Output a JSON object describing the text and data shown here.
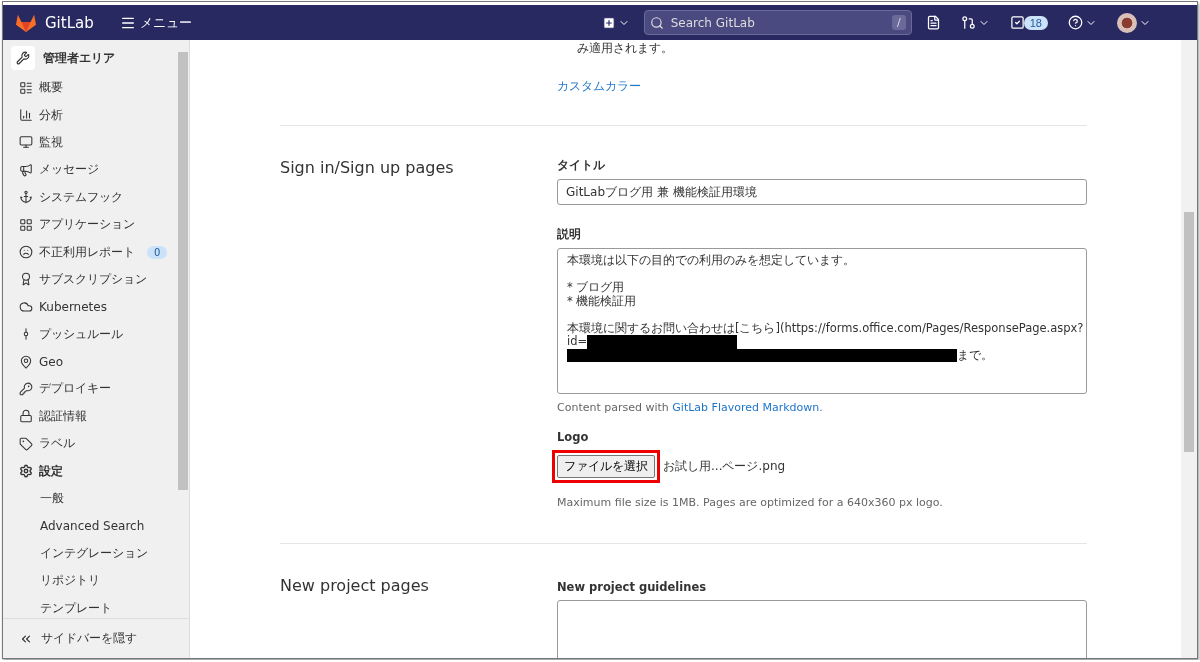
{
  "header": {
    "brand": "GitLab",
    "menu": "メニュー",
    "search": {
      "placeholder": "Search GitLab"
    },
    "search_key": "/",
    "todo_count": "18"
  },
  "sidebar": {
    "title": "管理者エリア",
    "items": [
      {
        "label": "概要",
        "selected": false
      },
      {
        "label": "分析",
        "selected": false
      },
      {
        "label": "監視",
        "selected": false
      },
      {
        "label": "メッセージ",
        "selected": false
      },
      {
        "label": "システムフック",
        "selected": false
      },
      {
        "label": "アプリケーション",
        "selected": false
      },
      {
        "label": "不正利用レポート",
        "selected": false,
        "badge": "0"
      },
      {
        "label": "サブスクリプション",
        "selected": false
      },
      {
        "label": "Kubernetes",
        "selected": false
      },
      {
        "label": "プッシュルール",
        "selected": false
      },
      {
        "label": "Geo",
        "selected": false
      },
      {
        "label": "デプロイキー",
        "selected": false
      },
      {
        "label": "認証情報",
        "selected": false
      },
      {
        "label": "ラベル",
        "selected": false
      },
      {
        "label": "設定",
        "selected": true,
        "children": [
          {
            "label": "一般",
            "selected": false
          },
          {
            "label": "Advanced Search",
            "selected": false
          },
          {
            "label": "インテグレーション",
            "selected": false
          },
          {
            "label": "リポジトリ",
            "selected": false
          },
          {
            "label": "テンプレート",
            "selected": false
          }
        ]
      }
    ],
    "collapse": "サイドバーを隠す"
  },
  "main": {
    "top_note": "み適用されます。",
    "custom_color_link": "カスタムカラー",
    "sign_in": {
      "heading": "Sign in/Sign up pages",
      "title_label": "タイトル",
      "title_value": "GitLabブログ用 兼 機能検証用環境",
      "description_label": "説明",
      "description_paragraphs": [
        {
          "lines": [
            {
              "parts": [
                {
                  "kind": "text",
                  "text": "本環境は以下の目的での利用のみを想定しています。"
                }
              ]
            }
          ]
        },
        {
          "lines": [
            {
              "parts": [
                {
                  "kind": "text",
                  "text": "* ブログ用"
                }
              ]
            },
            {
              "parts": [
                {
                  "kind": "text",
                  "text": "* 機能検証用"
                }
              ]
            }
          ]
        },
        {
          "lines": [
            {
              "parts": [
                {
                  "kind": "text",
                  "text": "本環境に関するお問い合わせは[こちら](https://forms.office.com/Pages/ResponsePage.aspx?"
                }
              ]
            },
            {
              "parts": [
                {
                  "kind": "text",
                  "text": "id="
                },
                {
                  "kind": "redaction"
                }
              ]
            },
            {
              "parts": [
                {
                  "kind": "redaction"
                },
                {
                  "kind": "text",
                  "text": "まで。"
                }
              ]
            }
          ]
        }
      ],
      "help_prefix": "Content parsed with ",
      "help_link": "GitLab Flavored Markdown",
      "help_suffix": ".",
      "logo_label": "Logo",
      "file_button": {
        "label": "ファイルを選択",
        "highlighted": true
      },
      "file_name": "お試し用...ページ.png",
      "logo_help": "Maximum file size is 1MB. Pages are optimized for a 640x360 px logo."
    },
    "new_project": {
      "heading": "New project pages",
      "guidelines_label": "New project guidelines"
    }
  }
}
